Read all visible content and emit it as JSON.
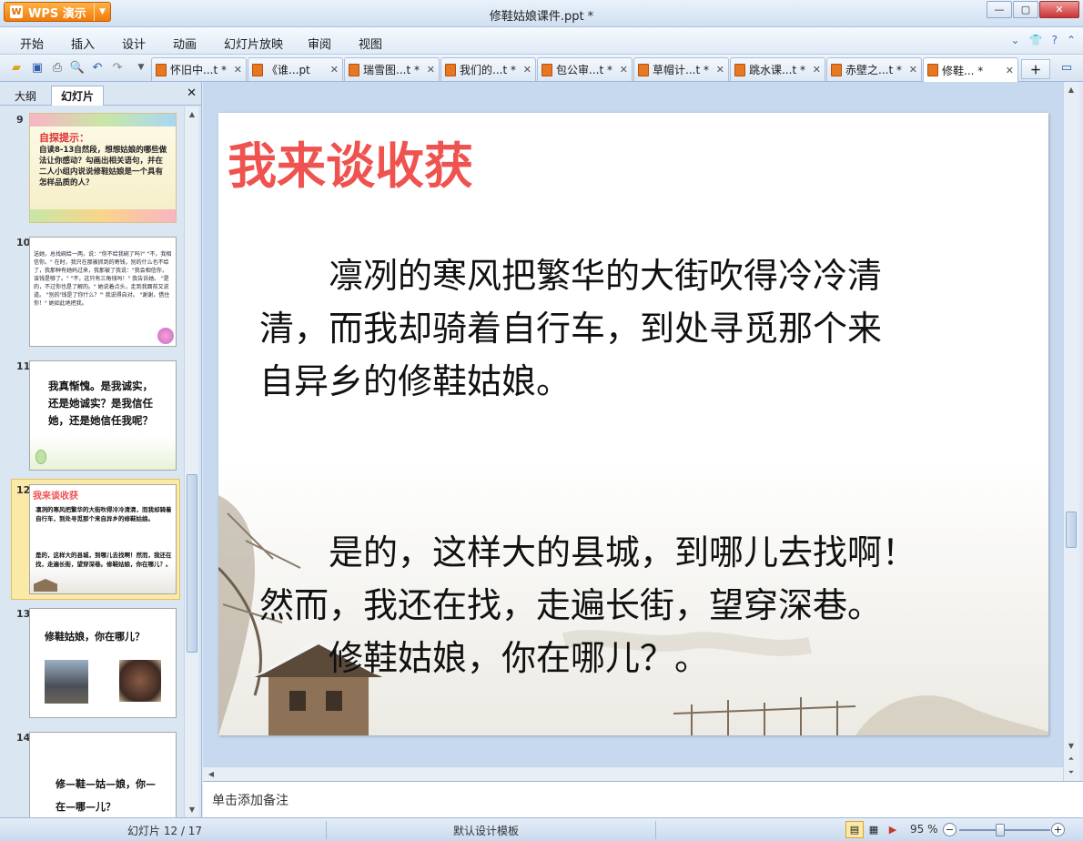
{
  "app": {
    "name": "WPS 演示",
    "doc_title": "修鞋姑娘课件.ppt *"
  },
  "menu": [
    "开始",
    "插入",
    "设计",
    "动画",
    "幻灯片放映",
    "审阅",
    "视图"
  ],
  "doc_tabs": [
    {
      "label": "怀旧中...t *"
    },
    {
      "label": "《谁...pt"
    },
    {
      "label": "瑞雪图...t *"
    },
    {
      "label": "我们的...t *"
    },
    {
      "label": "包公审...t *"
    },
    {
      "label": "草帽计...t *"
    },
    {
      "label": "跳水课...t *"
    },
    {
      "label": "赤壁之...t *"
    },
    {
      "label": "修鞋... *"
    }
  ],
  "panel": {
    "tab_outline": "大纲",
    "tab_slides": "幻灯片"
  },
  "thumbnails": [
    {
      "num": "9",
      "title": "自探提示：",
      "body": "自读8-13自然段，想想姑娘的哪些做法让你感动？勾画出相关语句，并在二人小组内说说修鞋姑娘是一个具有怎样品质的人？"
    },
    {
      "num": "10",
      "body": "送她，总找碗给一两，说：\"你不给我碗了吗?\" \"不，我相信你。\" 在时，我只在那被抓到的寄钱，别的什么也不给了，我那种有她妈过来，我那被了我说：\"我会相信你，该钱是够了。\" \"不，这只有三角钱吗！\" 我告诉她。 \"是的，不过你也是了解的。\" 她说着点头，走到我面前又说道。 \"别的'钱是了你什么？'\" 我说得自对。 \"谢谢，借住你！\" 她如此地把我。"
    },
    {
      "num": "11",
      "body": "我真惭愧。是我诚实，还是她诚实？是我信任她，还是她信任我呢？"
    },
    {
      "num": "12",
      "title": "我来谈收获",
      "body1": "凛冽的寒风把繁华的大街吹得冷冷清清，而我却骑着自行车，到处寻觅那个来自异乡的修鞋姑娘。",
      "body2": "是的，这样大的县城，到哪儿去找啊！然而，我还在找，走遍长街，望穿深巷。修鞋姑娘，你在哪儿？。"
    },
    {
      "num": "13",
      "title": "修鞋姑娘，你在哪儿？"
    },
    {
      "num": "14",
      "body": "修—鞋—姑—娘，你—在—哪—儿？"
    }
  ],
  "slide": {
    "title": "我来谈收获",
    "para1_lines": [
      "　　凛冽的寒风把繁华的大街吹得冷冷清",
      "清，而我却骑着自行车，到处寻觅那个来",
      "自异乡的修鞋姑娘。"
    ],
    "para2_lines": [
      "　　是的，这样大的县城，到哪儿去找啊！",
      "然而，我还在找，走遍长街，望穿深巷。",
      "　　修鞋姑娘，你在哪儿？。"
    ]
  },
  "notes_placeholder": "单击添加备注",
  "status": {
    "slide_counter": "幻灯片 12 / 17",
    "template": "默认设计模板",
    "zoom": "95 %"
  },
  "colors": {
    "title_red": "#ef5350",
    "wps_orange": "#f07b0b",
    "selected_thumb": "#fbe9a8"
  }
}
